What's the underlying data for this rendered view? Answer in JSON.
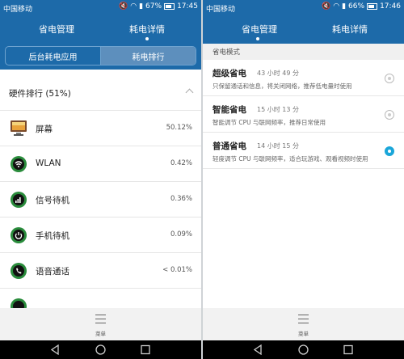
{
  "status_left": {
    "carrier": "中国移动",
    "battery": "67%",
    "time": "17:45"
  },
  "status_right": {
    "carrier": "中国移动",
    "battery": "66%",
    "time": "17:46"
  },
  "tabs": {
    "power_manage": "省电管理",
    "power_details": "耗电详情"
  },
  "segment": {
    "background_apps": "后台耗电应用",
    "ranking": "耗电排行"
  },
  "hardware": {
    "title": "硬件排行 (51%)",
    "items": [
      {
        "label": "屏幕",
        "pct": "50.12%",
        "icon": "screen-icon"
      },
      {
        "label": "WLAN",
        "pct": "0.42%",
        "icon": "wlan-icon"
      },
      {
        "label": "信号待机",
        "pct": "0.36%",
        "icon": "signal-icon"
      },
      {
        "label": "手机待机",
        "pct": "0.09%",
        "icon": "power-icon"
      },
      {
        "label": "语音通话",
        "pct": "< 0.01%",
        "icon": "phone-icon"
      }
    ]
  },
  "power_mode": {
    "header": "省电模式",
    "modes": [
      {
        "name": "超级省电",
        "time": "43 小时 49 分",
        "desc": "只保留通话和信息，将关闭网络，推荐低电量时使用",
        "selected": false
      },
      {
        "name": "智能省电",
        "time": "15 小时 13 分",
        "desc": "智能调节 CPU 与联网频率，推荐日常使用",
        "selected": false
      },
      {
        "name": "普通省电",
        "time": "14 小时 15 分",
        "desc": "轻度调节 CPU 与联网频率，适合玩游戏、观看视频时使用",
        "selected": true
      }
    ]
  },
  "menu_label": "菜单",
  "colors": {
    "primary": "#1d6aa9",
    "accent": "#1aa6d9",
    "icon_green": "#2a8c3c"
  }
}
